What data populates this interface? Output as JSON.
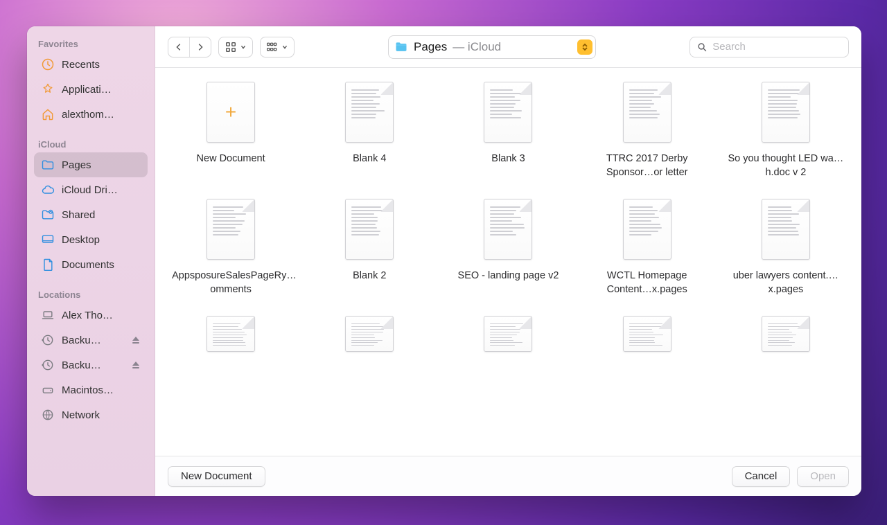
{
  "sidebar": {
    "sections": [
      {
        "label": "Favorites",
        "items": [
          {
            "icon": "clock",
            "label": "Recents"
          },
          {
            "icon": "app",
            "label": "Applicati…"
          },
          {
            "icon": "home",
            "label": "alexthom…"
          }
        ]
      },
      {
        "label": "iCloud",
        "items": [
          {
            "icon": "folder",
            "label": "Pages",
            "selected": true
          },
          {
            "icon": "cloud",
            "label": "iCloud Dri…"
          },
          {
            "icon": "shared",
            "label": "Shared"
          },
          {
            "icon": "desktop",
            "label": "Desktop"
          },
          {
            "icon": "doc",
            "label": "Documents"
          }
        ]
      },
      {
        "label": "Locations",
        "items": [
          {
            "icon": "laptop",
            "label": "Alex Tho…"
          },
          {
            "icon": "timemachine",
            "label": "Backu…",
            "eject": true
          },
          {
            "icon": "timemachine",
            "label": "Backu…",
            "eject": true
          },
          {
            "icon": "hdd",
            "label": "Macintos…"
          },
          {
            "icon": "globe",
            "label": "Network"
          }
        ]
      }
    ]
  },
  "toolbar": {
    "path_folder": "Pages",
    "path_location": " — iCloud",
    "search_placeholder": "Search"
  },
  "files": [
    {
      "name": "New Document",
      "kind": "new"
    },
    {
      "name": "Blank 4"
    },
    {
      "name": "Blank 3"
    },
    {
      "name": "TTRC 2017 Derby Sponsor…or letter"
    },
    {
      "name": "So you thought LED wa…h.doc v 2"
    },
    {
      "name": "AppsposureSalesPageRy…omments"
    },
    {
      "name": "Blank 2"
    },
    {
      "name": "SEO - landing page v2"
    },
    {
      "name": "WCTL Homepage Content…x.pages"
    },
    {
      "name": "uber lawyers content.…x.pages"
    },
    {
      "name": "",
      "partial": true
    },
    {
      "name": "",
      "partial": true
    },
    {
      "name": "",
      "partial": true
    },
    {
      "name": "",
      "partial": true
    },
    {
      "name": "",
      "partial": true
    }
  ],
  "footer": {
    "new_document": "New Document",
    "cancel": "Cancel",
    "open": "Open"
  }
}
